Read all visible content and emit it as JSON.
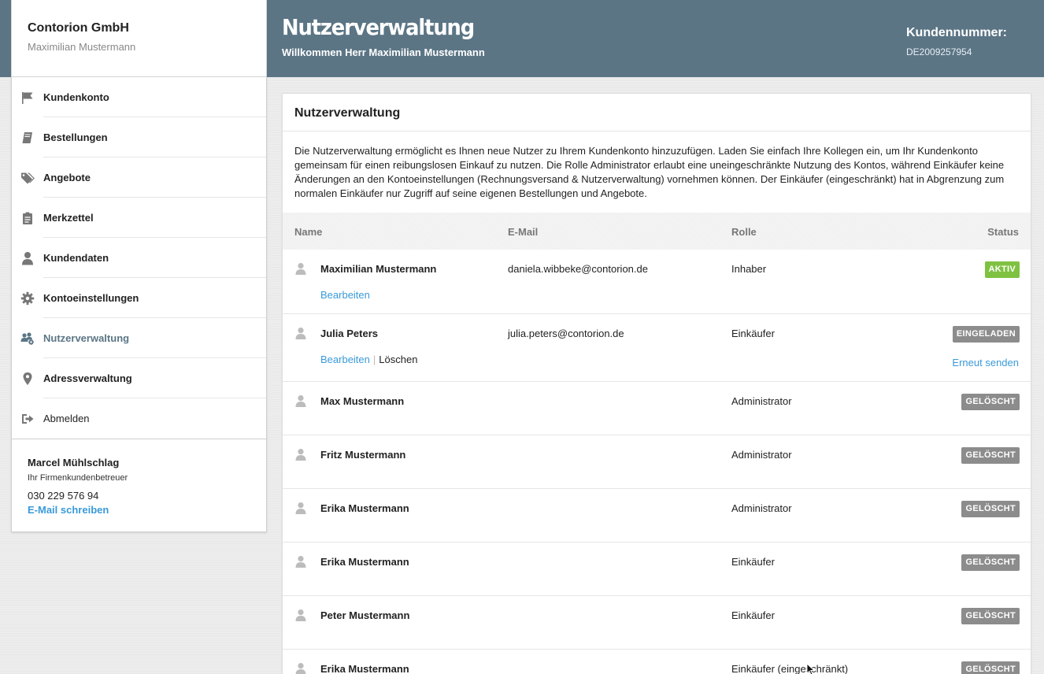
{
  "header": {
    "company": "Contorion GmbH",
    "user": "Maximilian Mustermann",
    "title": "Nutzerverwaltung",
    "welcome": "Willkommen Herr Maximilian Mustermann",
    "customer_number_label": "Kundennummer:",
    "customer_number": "DE2009257954"
  },
  "sidebar": {
    "items": [
      {
        "label": "Kundenkonto",
        "icon": "flag-icon"
      },
      {
        "label": "Bestellungen",
        "icon": "book-icon"
      },
      {
        "label": "Angebote",
        "icon": "tags-icon"
      },
      {
        "label": "Merkzettel",
        "icon": "clipboard-icon"
      },
      {
        "label": "Kundendaten",
        "icon": "user-icon"
      },
      {
        "label": "Kontoeinstellungen",
        "icon": "gear-icon"
      },
      {
        "label": "Nutzerverwaltung",
        "icon": "users-gear-icon",
        "active": true
      },
      {
        "label": "Adressverwaltung",
        "icon": "map-pin-icon"
      },
      {
        "label": "Abmelden",
        "icon": "sign-out-icon"
      }
    ],
    "contact": {
      "name": "Marcel Mühlschlag",
      "role": "Ihr Firmenkundenbetreuer",
      "phone": "030 229 576 94",
      "mail_link": "E-Mail schreiben"
    }
  },
  "main": {
    "title": "Nutzerverwaltung",
    "description": "Die Nutzerverwaltung ermöglicht es Ihnen neue Nutzer zu Ihrem Kundenkonto hinzuzufügen. Laden Sie einfach Ihre Kollegen ein, um Ihr Kundenkonto gemeinsam für einen reibungslosen Einkauf zu nutzen. Die Rolle Administrator erlaubt eine uneingeschränkte Nutzung des Kontos, während Einkäufer keine Änderungen an den Kontoeinstellungen (Rechnungsversand & Nutzerverwaltung) vornehmen können. Der Einkäufer (eingeschränkt) hat in Abgrenzung zum normalen Einkäufer nur Zugriff auf seine eigenen Bestellungen und Angebote.",
    "columns": {
      "name": "Name",
      "email": "E-Mail",
      "role": "Rolle",
      "status": "Status"
    },
    "actions": {
      "edit": "Bearbeiten",
      "delete": "Löschen",
      "resend": "Erneut senden"
    },
    "colors": {
      "active": "#7fc241",
      "invited": "#8c8c8c",
      "deleted": "#8c8c8c",
      "link": "#3a9ad9",
      "header": "#5b7585"
    },
    "users": [
      {
        "name": "Maximilian Mustermann",
        "email": "daniela.wibbeke@contorion.de",
        "role": "Inhaber",
        "status": "AKTIV"
      },
      {
        "name": "Julia Peters",
        "email": "julia.peters@contorion.de",
        "role": "Einkäufer",
        "status": "EINGELADEN"
      },
      {
        "name": "Max Mustermann",
        "email": "",
        "role": "Administrator",
        "status": "GELÖSCHT"
      },
      {
        "name": "Fritz Mustermann",
        "email": "",
        "role": "Administrator",
        "status": "GELÖSCHT"
      },
      {
        "name": "Erika Mustermann",
        "email": "",
        "role": "Administrator",
        "status": "GELÖSCHT"
      },
      {
        "name": "Erika Mustermann",
        "email": "",
        "role": "Einkäufer",
        "status": "GELÖSCHT"
      },
      {
        "name": "Peter Mustermann",
        "email": "",
        "role": "Einkäufer",
        "status": "GELÖSCHT"
      },
      {
        "name": "Erika Mustermann",
        "email": "",
        "role": "Einkäufer (eingeschränkt)",
        "status": "GELÖSCHT"
      }
    ]
  }
}
